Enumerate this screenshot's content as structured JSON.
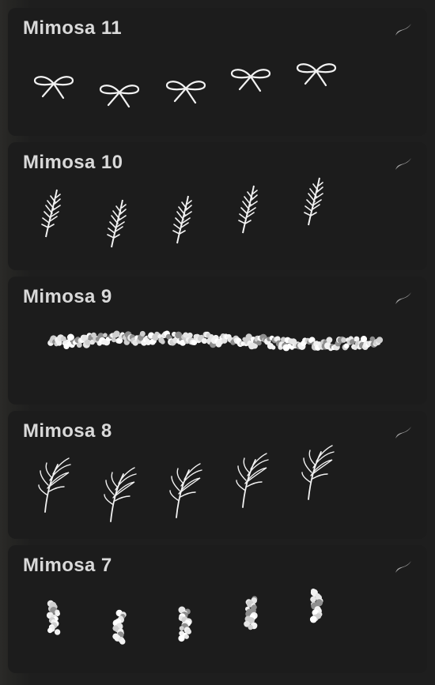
{
  "brushes": [
    {
      "name": "Mimosa 11",
      "preview": "bow",
      "icon": "brush-stroke-icon"
    },
    {
      "name": "Mimosa 10",
      "preview": "feather",
      "icon": "brush-stroke-icon"
    },
    {
      "name": "Mimosa 9",
      "preview": "bead-line",
      "icon": "brush-stroke-icon"
    },
    {
      "name": "Mimosa 8",
      "preview": "grass-sprig",
      "icon": "brush-stroke-icon"
    },
    {
      "name": "Mimosa 7",
      "preview": "bead-cluster",
      "icon": "brush-stroke-icon"
    }
  ],
  "colors": {
    "card": "#1c1c1c",
    "title": "#d9d9d9",
    "stroke": "#f2f2f2",
    "icon": "#a6a6a6"
  }
}
